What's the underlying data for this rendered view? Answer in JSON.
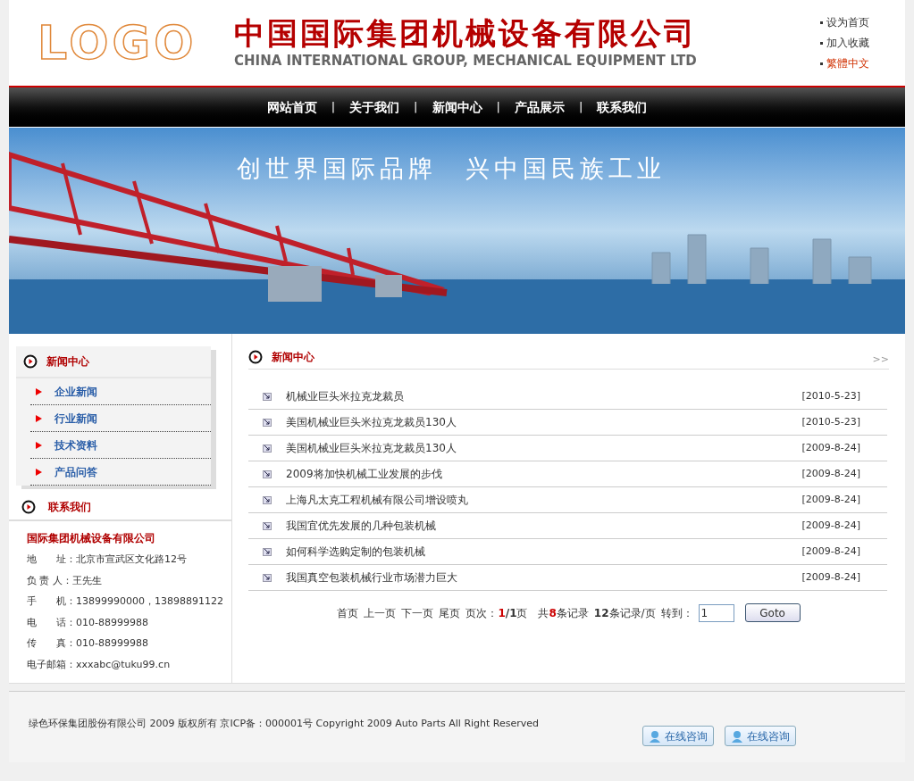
{
  "header": {
    "logo": "LOGO",
    "company_cn": "中国国际集团机械设备有限公司",
    "company_en": "CHINA INTERNATIONAL GROUP, MECHANICAL EQUIPMENT LTD",
    "quick_links": [
      {
        "label": "设为首页",
        "highlight": false
      },
      {
        "label": "加入收藏",
        "highlight": false
      },
      {
        "label": "繁體中文",
        "highlight": true
      }
    ]
  },
  "nav": [
    "网站首页",
    "关于我们",
    "新闻中心",
    "产品展示",
    "联系我们"
  ],
  "nav_separator": "|",
  "banner": {
    "slogan": "创世界国际品牌　兴中国民族工业"
  },
  "sidebar": {
    "news_title": "新闻中心",
    "news_items": [
      "企业新闻",
      "行业新闻",
      "技术资料",
      "产品问答"
    ],
    "contact_title": "联系我们",
    "company": "国际集团机械设备有限公司",
    "contacts": [
      {
        "label": "地　　址：",
        "value": "北京市宣武区文化路12号"
      },
      {
        "label": "负 责 人：",
        "value": "王先生"
      },
      {
        "label": "手　　机：",
        "value": "13899990000，13898891122"
      },
      {
        "label": "电　　话：",
        "value": "010-88999988"
      },
      {
        "label": "传　　真：",
        "value": "010-88999988"
      },
      {
        "label": "电子邮箱：",
        "value": "xxxabc@tuku99.cn"
      }
    ]
  },
  "news": {
    "title": "新闻中心",
    "more": ">>",
    "rows": [
      {
        "title": "机械业巨头米拉克龙裁员",
        "date": "[2010-5-23]"
      },
      {
        "title": "美国机械业巨头米拉克龙裁员130人",
        "date": "[2010-5-23]"
      },
      {
        "title": "美国机械业巨头米拉克龙裁员130人",
        "date": "[2009-8-24]"
      },
      {
        "title": "2009将加快机械工业发展的步伐",
        "date": "[2009-8-24]"
      },
      {
        "title": "上海凡太克工程机械有限公司增设喷丸",
        "date": "[2009-8-24]"
      },
      {
        "title": "我国宜优先发展的几种包装机械",
        "date": "[2009-8-24]"
      },
      {
        "title": "如何科学选购定制的包装机械",
        "date": "[2009-8-24]"
      },
      {
        "title": "我国真空包装机械行业市场潜力巨大",
        "date": "[2009-8-24]"
      }
    ]
  },
  "pagination": {
    "links": [
      "首页",
      "上一页",
      "下一页",
      "尾页"
    ],
    "page_label": "页次：",
    "current": "1",
    "total": "/1页",
    "records": {
      "prefix": "共",
      "count": "8",
      "suffix": "条记录"
    },
    "per_page": "**12**条记录/页",
    "goto_label": "转到：",
    "goto_value": "1",
    "goto_button": "Goto"
  },
  "footer": {
    "copyright": "绿色环保集团股份有限公司 2009 版权所有 京ICP备：000001号 Copyright 2009 Auto Parts All Right Reserved",
    "consult_buttons": [
      "在线咨询",
      "在线咨询"
    ]
  }
}
